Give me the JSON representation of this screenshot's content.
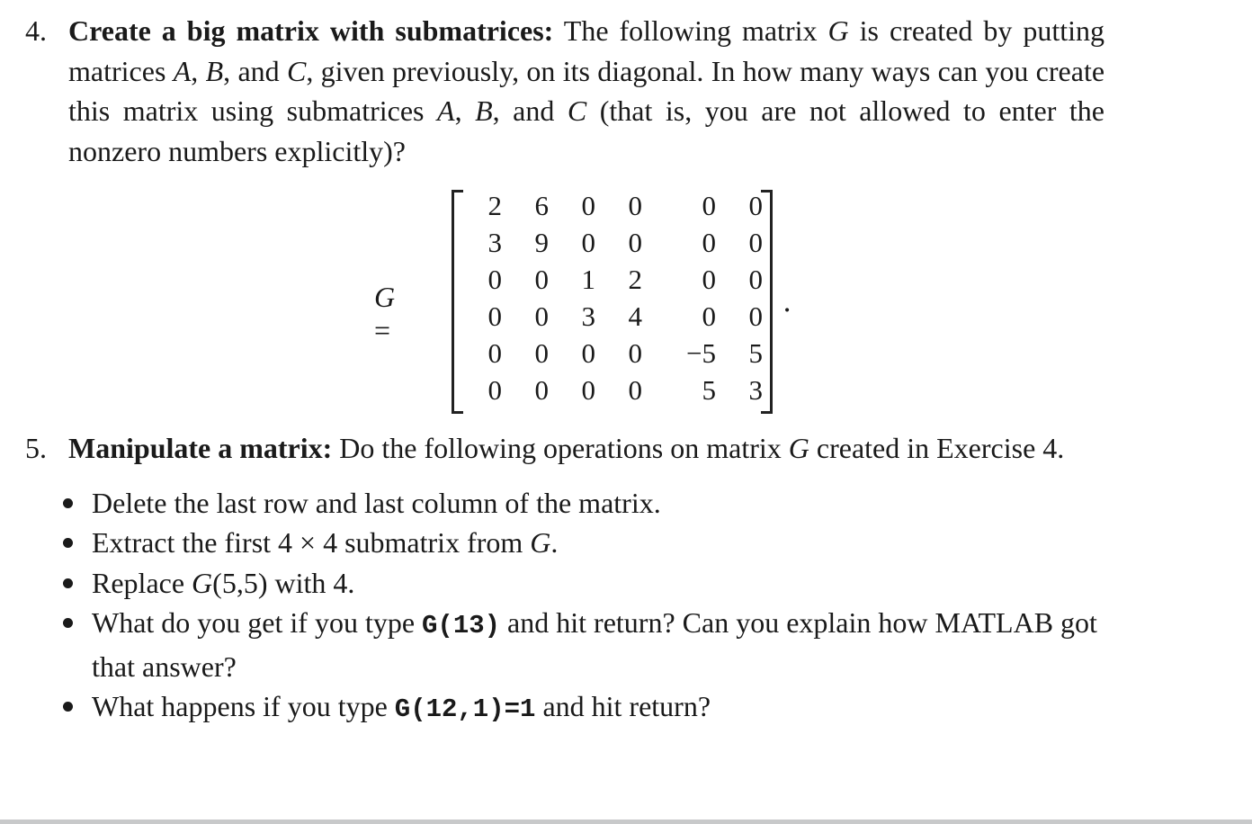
{
  "exercise4": {
    "number": "4.",
    "title": "Create a big matrix with submatrices:",
    "text_1": " The following matrix ",
    "G": "G",
    "text_2": " is created by putting matrices ",
    "A": "A",
    "sep1": ", ",
    "B": "B",
    "sep2": ", and ",
    "C": "C",
    "text_3": ", given previously, on its diagonal. In how many ways can you create this matrix using submatrices ",
    "sep3": ", ",
    "sep4": ", and ",
    "text_4": " (that is, you are not allowed to enter the nonzero numbers explicitly)?",
    "equation": {
      "lhs_var": "G",
      "equals": " =",
      "period": ".",
      "rows": [
        [
          "2",
          "6",
          "0",
          "0",
          "0",
          "0"
        ],
        [
          "3",
          "9",
          "0",
          "0",
          "0",
          "0"
        ],
        [
          "0",
          "0",
          "1",
          "2",
          "0",
          "0"
        ],
        [
          "0",
          "0",
          "3",
          "4",
          "0",
          "0"
        ],
        [
          "0",
          "0",
          "0",
          "0",
          "−5",
          "5"
        ],
        [
          "0",
          "0",
          "0",
          "0",
          "5",
          "3"
        ]
      ]
    }
  },
  "exercise5": {
    "number": "5.",
    "title": "Manipulate a matrix:",
    "text_1": " Do the following operations on matrix ",
    "G": "G",
    "text_2": " created in Exercise 4.",
    "bullets": [
      {
        "text_a": "Delete the last row and last column of the matrix."
      },
      {
        "text_a": "Extract the first 4 × 4 submatrix from ",
        "var": "G",
        "text_b": "."
      },
      {
        "text_a": "Replace ",
        "var": "G",
        "text_b": "(5,5) with 4."
      },
      {
        "text_a": "What do you get if you type ",
        "code": "G(13)",
        "text_b": " and hit return? Can you explain how MATLAB got that answer?"
      },
      {
        "text_a": "What happens if you type ",
        "code": "G(12,1)=1",
        "text_b": " and hit return?"
      }
    ]
  }
}
